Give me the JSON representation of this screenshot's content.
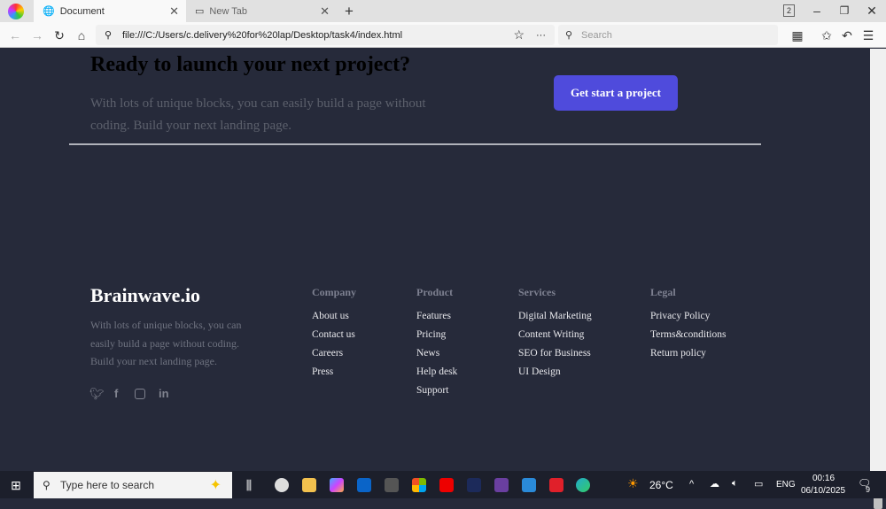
{
  "browser": {
    "tabs": [
      {
        "title": "Document",
        "icon": "globe-icon"
      },
      {
        "title": "New Tab",
        "icon": "newtab-icon"
      }
    ],
    "url": "file:///C:/Users/c.delivery%20for%20lap/Desktop/task4/index.html",
    "search_placeholder": "Search",
    "tab_count": "2"
  },
  "cta": {
    "heading": "Ready to launch your next project?",
    "text": "With lots of unique blocks, you can easily build a page without coding. Build your next landing page.",
    "button": "Get start a project",
    "accent": "#4f4bdc"
  },
  "footer": {
    "brand": "Brainwave.io",
    "description": "With lots of unique blocks, you can easily build a page without coding. Build your next landing page.",
    "social": [
      "twitter-icon",
      "facebook-icon",
      "instagram-icon",
      "linkedin-icon"
    ],
    "columns": [
      {
        "title": "Company",
        "links": [
          "About us",
          "Contact us",
          "Careers",
          "Press"
        ]
      },
      {
        "title": "Product",
        "links": [
          "Features",
          "Pricing",
          "News",
          "Help desk",
          "Support"
        ]
      },
      {
        "title": "Services",
        "links": [
          "Digital Marketing",
          "Content Writing",
          "SEO for Business",
          "UI Design"
        ]
      },
      {
        "title": "Legal",
        "links": [
          "Privacy Policy",
          "Terms&conditions",
          "Return policy"
        ]
      }
    ]
  },
  "taskbar": {
    "search_placeholder": "Type here to search",
    "weather": "26°C",
    "lang": "ENG",
    "time": "00:16",
    "date": "06/10/2025",
    "notifications": "9"
  }
}
